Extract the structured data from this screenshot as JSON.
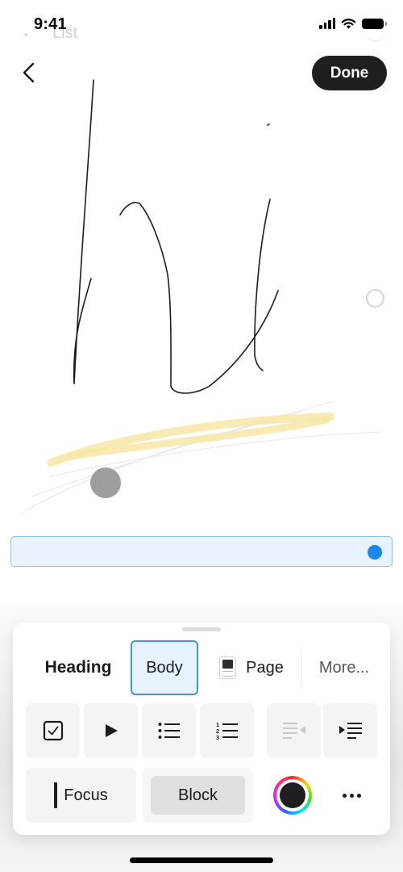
{
  "status_bar": {
    "time": "9:41",
    "icons": [
      "cellular-signal-icon",
      "wifi-icon",
      "battery-icon"
    ]
  },
  "background_ghost": {
    "list_label": "List"
  },
  "header": {
    "back_icon": "chevron-left-icon",
    "done_label": "Done"
  },
  "canvas": {
    "ink_color": "#1c1c1e",
    "highlighter_color": "#f7e6a4",
    "ghost_stroke_color": "#dfe8f2",
    "cursor_color": "#9d9c9f",
    "selected_block_dot_color": "#1a86f0"
  },
  "toolbar": {
    "styles": [
      {
        "id": "heading",
        "label": "Heading"
      },
      {
        "id": "body",
        "label": "Body",
        "selected": true
      },
      {
        "id": "page",
        "label": "Page",
        "icon": "page-icon"
      },
      {
        "id": "more",
        "label": "More..."
      }
    ],
    "tools": [
      {
        "id": "checkbox",
        "icon": "checkbox-icon"
      },
      {
        "id": "toggle",
        "icon": "play-triangle-icon"
      },
      {
        "id": "bulleted-list",
        "icon": "bulleted-list-icon"
      },
      {
        "id": "numbered-list",
        "icon": "numbered-list-icon"
      },
      {
        "id": "outdent",
        "icon": "outdent-icon",
        "disabled": true
      },
      {
        "id": "indent",
        "icon": "indent-icon"
      }
    ],
    "focus_label": "Focus",
    "block_label": "Block",
    "current_color": "#1f1f22",
    "more_icon": "ellipsis-icon"
  }
}
